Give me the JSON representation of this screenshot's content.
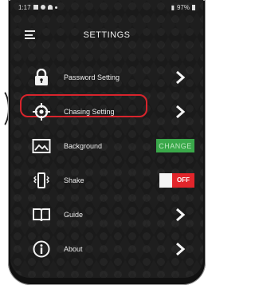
{
  "status_bar": {
    "time": "1:17",
    "battery": "97%"
  },
  "header": {
    "title": "SETTINGS"
  },
  "items": [
    {
      "label": "Password Setting",
      "icon": "lock-icon",
      "action": "chevron"
    },
    {
      "label": "Chasing Setting",
      "icon": "crosshair-icon",
      "action": "chevron",
      "highlighted": true
    },
    {
      "label": "Background",
      "icon": "image-icon",
      "action": "button",
      "button_label": "CHANGE"
    },
    {
      "label": "Shake",
      "icon": "shake-icon",
      "action": "toggle",
      "toggle_label": "OFF"
    },
    {
      "label": "Guide",
      "icon": "book-icon",
      "action": "chevron"
    },
    {
      "label": "About",
      "icon": "info-icon",
      "action": "chevron"
    }
  ],
  "colors": {
    "highlight": "#d8242c",
    "change_button": "#3aa84a",
    "toggle_off": "#e2252b"
  }
}
